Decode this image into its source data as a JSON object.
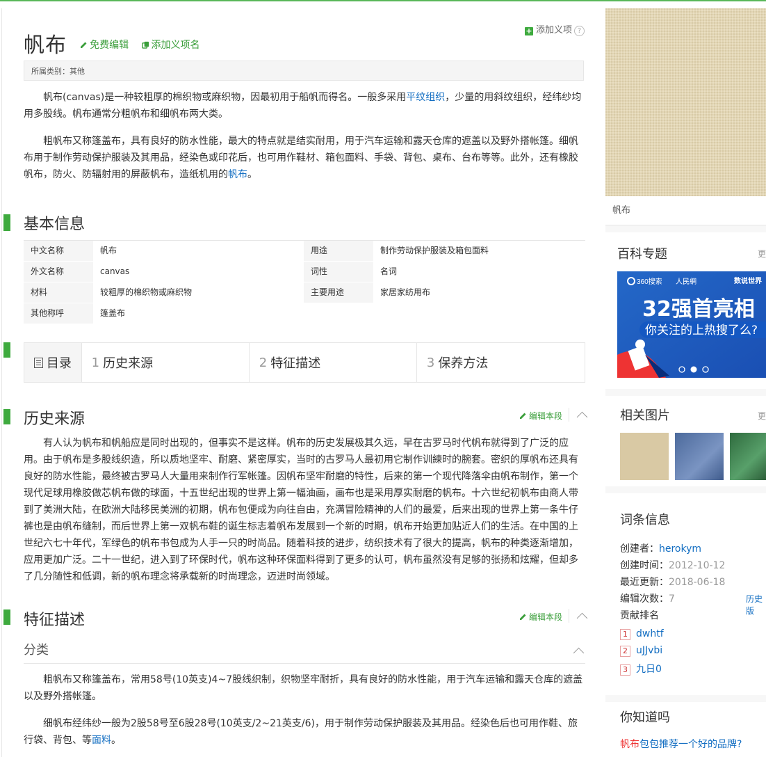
{
  "header": {
    "title": "帆布",
    "free_edit": "免费编辑",
    "add_sense_name": "添加义项名",
    "add_sense": "添加义项",
    "help_mark": "?",
    "category": "所属类别：其他"
  },
  "intro": {
    "p1_a": "帆布(canvas)是一种较粗厚的棉织物或麻织物，因最初用于船帆而得名。一般多采用",
    "p1_link": "平纹组织",
    "p1_b": "，少量的用斜纹组织，经纬纱均用多股线。帆布通常分粗帆布和细帆布两大类。",
    "p2_a": "粗帆布又称篷盖布，具有良好的防水性能，最大的特点就是结实耐用，用于汽车运输和露天仓库的遮盖以及野外搭帐篷。细帆布用于制作劳动保护服装及其用品，经染色或印花后，也可用作鞋材、箱包面料、手袋、背包、桌布、台布等等。此外，还有橡胶帆布，防火、防辐射用的屏蔽帆布，造纸机用的",
    "p2_link": "帆布",
    "p2_b": "。"
  },
  "basic_info": {
    "title": "基本信息",
    "rows": [
      {
        "k1": "中文名称",
        "v1": "帆布",
        "k2": "用途",
        "v2": "制作劳动保护服装及箱包面料"
      },
      {
        "k1": "外文名称",
        "v1": "canvas",
        "k2": "词性",
        "v2": "名词"
      },
      {
        "k1": "材料",
        "v1": "较粗厚的棉织物或麻织物",
        "k2": "主要用途",
        "v2": "家居家纺用布"
      },
      {
        "k1": "其他称呼",
        "v1": "篷盖布",
        "k2": "",
        "v2": ""
      }
    ]
  },
  "toc": {
    "label": "目录",
    "items": [
      {
        "num": "1",
        "label": "历史来源"
      },
      {
        "num": "2",
        "label": "特征描述"
      },
      {
        "num": "3",
        "label": "保养方法"
      }
    ]
  },
  "history": {
    "title": "历史来源",
    "edit": "编辑本段",
    "text": "有人认为帆布和帆船应是同时出现的，但事实不是这样。帆布的历史发展极其久远，早在古罗马时代帆布就得到了广泛的应用。由于帆布是多股线织造，所以质地坚牢、耐磨、紧密厚实，当时的古罗马人最初用它制作训練时的腕套。密织的厚帆布还具有良好的防水性能，最终被古罗马人大量用来制作行军帐篷。因帆布坚牢耐磨的特性，后来的第一个现代降落伞由帆布制作，第一个现代足球用橡胶做芯帆布做的球面，十五世纪出现的世界上第一幅油画，画布也是采用厚实耐磨的帆布。十六世纪初帆布由商人带到了美洲大陆，在欧洲大陆移民美洲的初期，帆布包便成为向往自由，充满冒险精神的人们的最爱，后来出现的世界上第一条牛仔裤也是由帆布缝制，而后世界上第一双帆布鞋的诞生标志着帆布发展到一个新的时期，帆布开始更加贴近人们的生活。在中国的上世纪六七十年代，军绿色的帆布书包成为人手一只的时尚品。随着科技的进步，纺织技术有了很大的提高，帆布的种类逐渐增加，应用更加广泛。二十一世纪，进入到了环保时代，帆布这种环保面料得到了更多的认可，帆布虽然没有足够的张扬和炫耀，但却多了几分随性和低调，新的帆布理念将承载新的时尚理念，迈进时尚领域。"
  },
  "features": {
    "title": "特征描述",
    "edit": "编辑本段",
    "sub_title": "分类",
    "p1": "粗帆布又称篷盖布，常用58号(10英支)4~7股线织制，织物坚牢耐折，具有良好的防水性能，用于汽车运输和露天仓库的遮盖以及野外搭帐篷。",
    "p2_a": "细帆布经纬纱一般为2股58号至6股28号(10英支/2~21英支/6)，用于制作劳动保护服装及其用品。经染色后也可用作鞋、旅行袋、背包、等",
    "p2_link": "面料",
    "p2_b": "。"
  },
  "sidebar": {
    "image_caption": "帆布",
    "topics_title": "百科专题",
    "topics_more": "更",
    "banner": {
      "brand1": "360搜索",
      "brand2": "人民網",
      "tagline": "数说世界",
      "headline": "32强首亮相",
      "subline": "你关注的上热搜了么?"
    },
    "related_title": "相关图片",
    "related_more": "更",
    "entry_title": "词条信息",
    "creator_label": "创建者：",
    "creator": "herokym",
    "created_label": "创建时间：",
    "created": "2012-10-12",
    "updated_label": "最近更新：",
    "updated": "2018-06-18",
    "edits_label": "编辑次数：",
    "edits": "7",
    "history_link": "历史版",
    "contrib_label": "贡献排名",
    "contributors": [
      {
        "rank": "1",
        "name": "dwhtf"
      },
      {
        "rank": "2",
        "name": "uJJvbi"
      },
      {
        "rank": "3",
        "name": "九日0"
      }
    ],
    "know_title": "你知道吗",
    "know_hl": "帆布",
    "know_rest": "包包推荐一个好的品牌?"
  },
  "colors": {
    "accent": "#3eaa3e",
    "link": "#136ec2"
  }
}
